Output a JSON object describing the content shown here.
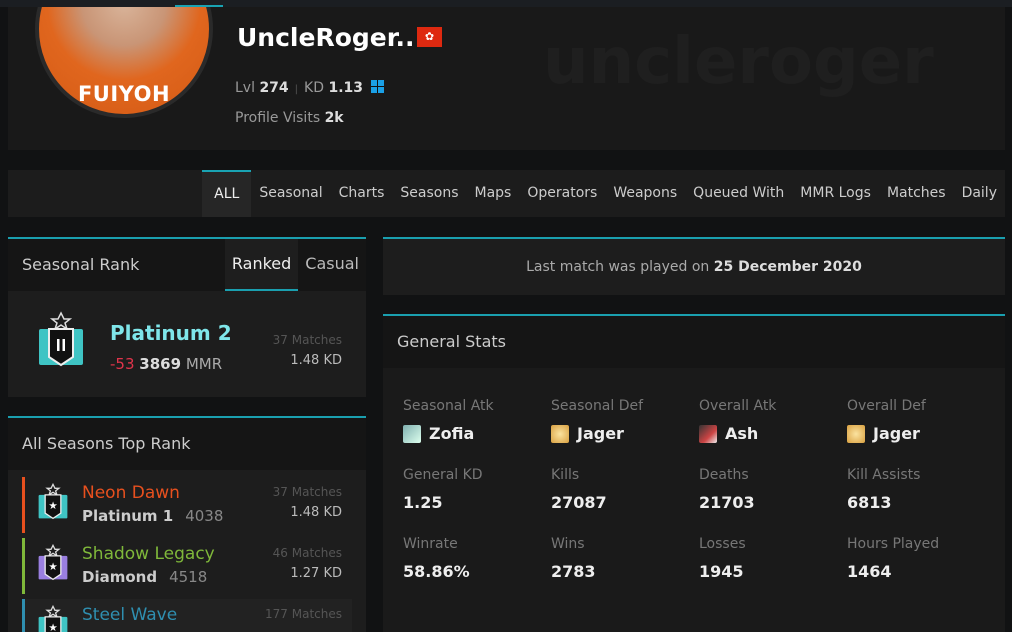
{
  "profile": {
    "watermark": "uncleroger",
    "avatar_caption": "FUIYOH",
    "name": "UncleRoger...",
    "flag": "hong-kong-flag",
    "level_label": "Lvl",
    "level": "274",
    "kd_label": "KD",
    "kd": "1.13",
    "platform": "windows-icon",
    "visits_label": "Profile Visits",
    "visits": "2k"
  },
  "nav": {
    "tabs": [
      {
        "label": "ALL",
        "active": true
      },
      {
        "label": "Seasonal"
      },
      {
        "label": "Charts"
      },
      {
        "label": "Seasons"
      },
      {
        "label": "Maps"
      },
      {
        "label": "Operators"
      },
      {
        "label": "Weapons"
      },
      {
        "label": "Queued With"
      },
      {
        "label": "MMR Logs"
      },
      {
        "label": "Matches"
      },
      {
        "label": "Daily"
      }
    ]
  },
  "seasonal_rank": {
    "title": "Seasonal Rank",
    "tabs": [
      "Ranked",
      "Casual"
    ],
    "rank": "Platinum 2",
    "delta": "-53",
    "mmr": "3869",
    "mmr_label": "MMR",
    "matches": "37 Matches",
    "kd": "1.48 KD"
  },
  "all_seasons": {
    "title": "All Seasons Top Rank",
    "items": [
      {
        "season": "Neon Dawn",
        "color": "#e8501e",
        "rank": "Platinum 1",
        "mmr": "4038",
        "matches": "37 Matches",
        "kd": "1.48 KD"
      },
      {
        "season": "Shadow Legacy",
        "color": "#7fb83a",
        "rank": "Diamond",
        "mmr": "4518",
        "matches": "46 Matches",
        "kd": "1.27 KD"
      },
      {
        "season": "Steel Wave",
        "color": "#2f8fb0",
        "rank": "",
        "mmr": "",
        "matches": "177 Matches",
        "kd": ""
      }
    ]
  },
  "last_match": {
    "prefix": "Last match was played on",
    "date": "25 December 2020"
  },
  "general_stats": {
    "title": "General Stats",
    "cells": [
      {
        "label": "Seasonal Atk",
        "value": "Zofia",
        "icon": "zofia-icon"
      },
      {
        "label": "Seasonal Def",
        "value": "Jager",
        "icon": "jager-icon"
      },
      {
        "label": "Overall Atk",
        "value": "Ash",
        "icon": "ash-icon"
      },
      {
        "label": "Overall Def",
        "value": "Jager",
        "icon": "jager-icon"
      },
      {
        "label": "General KD",
        "value": "1.25"
      },
      {
        "label": "Kills",
        "value": "27087"
      },
      {
        "label": "Deaths",
        "value": "21703"
      },
      {
        "label": "Kill Assists",
        "value": "6813"
      },
      {
        "label": "Winrate",
        "value": "58.86%"
      },
      {
        "label": "Wins",
        "value": "2783"
      },
      {
        "label": "Losses",
        "value": "1945"
      },
      {
        "label": "Hours Played",
        "value": "1464"
      }
    ]
  },
  "colors": {
    "accent": "#1a9faf",
    "negative": "#e0344b",
    "platinum": "#7fe6ea"
  }
}
